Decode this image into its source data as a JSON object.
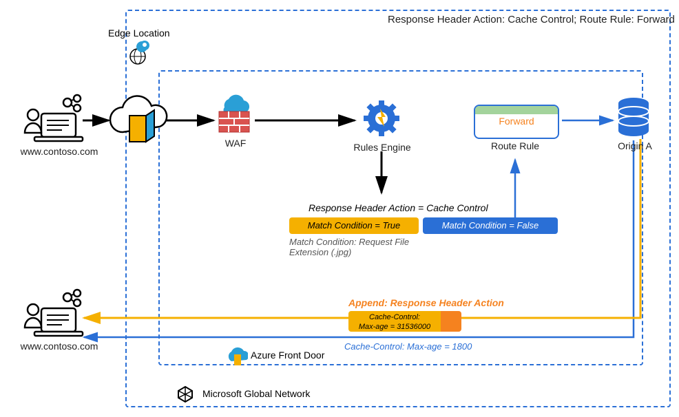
{
  "title": "Response Header Action: Cache Control; Route Rule: Forward",
  "edge_location_label": "Edge Location",
  "user1_url": "www.contoso.com",
  "user2_url": "www.contoso.com",
  "waf_label": "WAF",
  "rules_engine_label": "Rules Engine",
  "route_rule_label": "Route Rule",
  "route_rule_action": "Forward",
  "origin_label": "Origin A",
  "response_header_action_text": "Response Header Action = Cache Control",
  "match_true_text": "Match Condition = True",
  "match_false_text": "Match Condition = False",
  "match_condition_note": "Match Condition: Request File Extension (.jpg)",
  "append_label": "Append: Response Header Action",
  "append_cache_control_line1": "Cache-Control:",
  "append_cache_control_line2": "Max-age = 31536000",
  "blue_cache_control": "Cache-Control: Max-age = 1800",
  "afd_label": "Azure Front Door",
  "mgn_label": "Microsoft Global Network",
  "chart_data": {
    "type": "table",
    "flow_nodes": [
      {
        "id": "user-top",
        "label": "www.contoso.com"
      },
      {
        "id": "edge-door",
        "label": "Edge Location / Front Door"
      },
      {
        "id": "waf",
        "label": "WAF"
      },
      {
        "id": "rules-engine",
        "label": "Rules Engine"
      },
      {
        "id": "match-true",
        "label": "Match Condition = True",
        "action": "Response Header Action = Cache Control"
      },
      {
        "id": "match-false",
        "label": "Match Condition = False"
      },
      {
        "id": "route-rule",
        "label": "Route Rule",
        "action": "Forward"
      },
      {
        "id": "origin-a",
        "label": "Origin A"
      },
      {
        "id": "user-bottom",
        "label": "www.contoso.com"
      }
    ],
    "flow_edges": [
      {
        "from": "user-top",
        "to": "edge-door",
        "color": "black"
      },
      {
        "from": "edge-door",
        "to": "waf",
        "color": "black"
      },
      {
        "from": "waf",
        "to": "rules-engine",
        "color": "black"
      },
      {
        "from": "rules-engine",
        "to": "match-true",
        "color": "black",
        "note": "Match Condition: Request File Extension (.jpg)"
      },
      {
        "from": "match-false",
        "to": "route-rule",
        "color": "blue"
      },
      {
        "from": "route-rule",
        "to": "origin-a",
        "color": "blue"
      },
      {
        "from": "origin-a",
        "to": "user-bottom",
        "color": "blue",
        "label": "Cache-Control: Max-age = 1800"
      },
      {
        "from": "origin-a",
        "to": "user-bottom",
        "color": "yellow",
        "label": "Append: Response Header Action",
        "detail": "Cache-Control: Max-age = 31536000"
      }
    ],
    "containers": [
      {
        "label": "Azure Front Door"
      },
      {
        "label": "Microsoft Global Network"
      }
    ]
  }
}
